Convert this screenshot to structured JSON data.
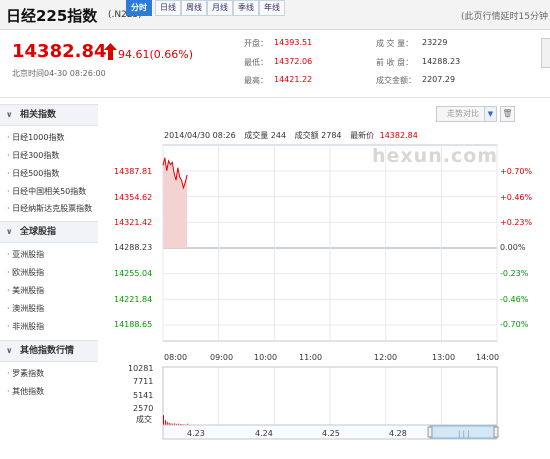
{
  "header": {
    "title": "日经225指数",
    "code": "(.N225)",
    "note": "(此页行情延时15分钟"
  },
  "quote": {
    "price": "14382.84",
    "change": "94.61(0.66%)",
    "time": "北京时间04-30  08:26:00",
    "stats": [
      {
        "label": "开盘：",
        "value": "14393.51",
        "color": "red"
      },
      {
        "label": "最低：",
        "value": "14372.06",
        "color": "red"
      },
      {
        "label": "最高：",
        "value": "14421.22",
        "color": "red"
      },
      {
        "label": "成 交 量：",
        "value": "23229",
        "color": "dark"
      },
      {
        "label": "前 收 盘：",
        "value": "14288.23",
        "color": "dark"
      },
      {
        "label": "成交金额：",
        "value": "2207.29",
        "color": "dark"
      }
    ]
  },
  "sidebar": {
    "sections": [
      {
        "title": "相关指数",
        "items": [
          "· 日经1000指数",
          "· 日经300指数",
          "· 日经500指数",
          "· 日经中国相关50指数",
          "· 日经纳斯达克股票指数"
        ]
      },
      {
        "title": "全球股指",
        "items": [
          "· 亚洲股指",
          "· 欧洲股指",
          "· 美洲股指",
          "· 澳洲股指",
          "· 非洲股指"
        ]
      },
      {
        "title": "其他指数行情",
        "items": [
          "· 罗素指数",
          "· 其他指数"
        ]
      }
    ]
  },
  "chart_tabs": [
    "分时",
    "日线",
    "周线",
    "月线",
    "季线",
    "年线"
  ],
  "compare_label": "走势对比",
  "info_bar": {
    "datetime": "2014/04/30 08:26",
    "volume": "成交量 244",
    "amount": "成交额 2784",
    "latest_label": "最新价",
    "latest": "14382.84"
  },
  "watermark": "hexun.com",
  "chart_data": {
    "type": "area",
    "xlabel": "",
    "ylabel": "",
    "prev_close": 14288.23,
    "ylim": [
      14188.65,
      14387.81
    ],
    "y_ticks_left": [
      "14387.81",
      "14354.62",
      "14321.42",
      "14288.23",
      "14255.04",
      "14221.84",
      "14188.65"
    ],
    "y_ticks_right": [
      "+0.70%",
      "+0.46%",
      "+0.23%",
      "0.00%",
      "-0.23%",
      "-0.46%",
      "-0.70%"
    ],
    "x_ticks": [
      "08:00",
      "09:00",
      "10:00",
      "11:00",
      "12:00",
      "13:00",
      "14:00"
    ],
    "series": [
      {
        "x": [
          "08:00",
          "08:02",
          "08:04",
          "08:06",
          "08:08",
          "08:10",
          "08:12",
          "08:14",
          "08:16",
          "08:18",
          "08:20",
          "08:22",
          "08:24",
          "08:26"
        ],
        "values": [
          14395,
          14405,
          14388,
          14401,
          14396,
          14399,
          14385,
          14376,
          14392,
          14380,
          14376,
          14366,
          14373,
          14382.84
        ]
      }
    ],
    "volume_ticks": [
      "10281",
      "7711",
      "5141",
      "2570",
      "成交"
    ],
    "volume": [
      1800,
      900,
      600,
      400,
      300,
      250,
      300,
      200,
      250,
      200,
      180,
      150,
      120,
      244
    ],
    "volume_max": 10281,
    "date_ticks": [
      "4.23",
      "4.24",
      "4.25",
      "4.28"
    ]
  }
}
